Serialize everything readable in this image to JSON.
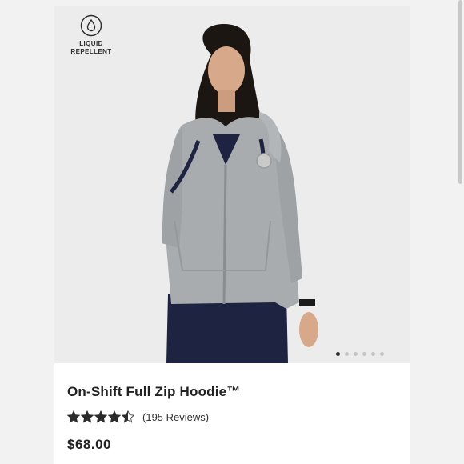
{
  "badge": {
    "text": "LIQUID\nREPELLENT",
    "icon": "droplet-icon"
  },
  "product": {
    "name": "On-Shift Full Zip Hoodie™",
    "rating": 4.5,
    "rating_max": 5,
    "reviews_open": "(",
    "reviews_text": "195 Reviews",
    "reviews_close": ")",
    "price": "$68.00"
  },
  "carousel": {
    "slide_count": 6,
    "active_index": 0
  },
  "colors": {
    "star": "#2b2b2b",
    "hoodie": "#a9acae",
    "scrubs": "#1d2340"
  }
}
